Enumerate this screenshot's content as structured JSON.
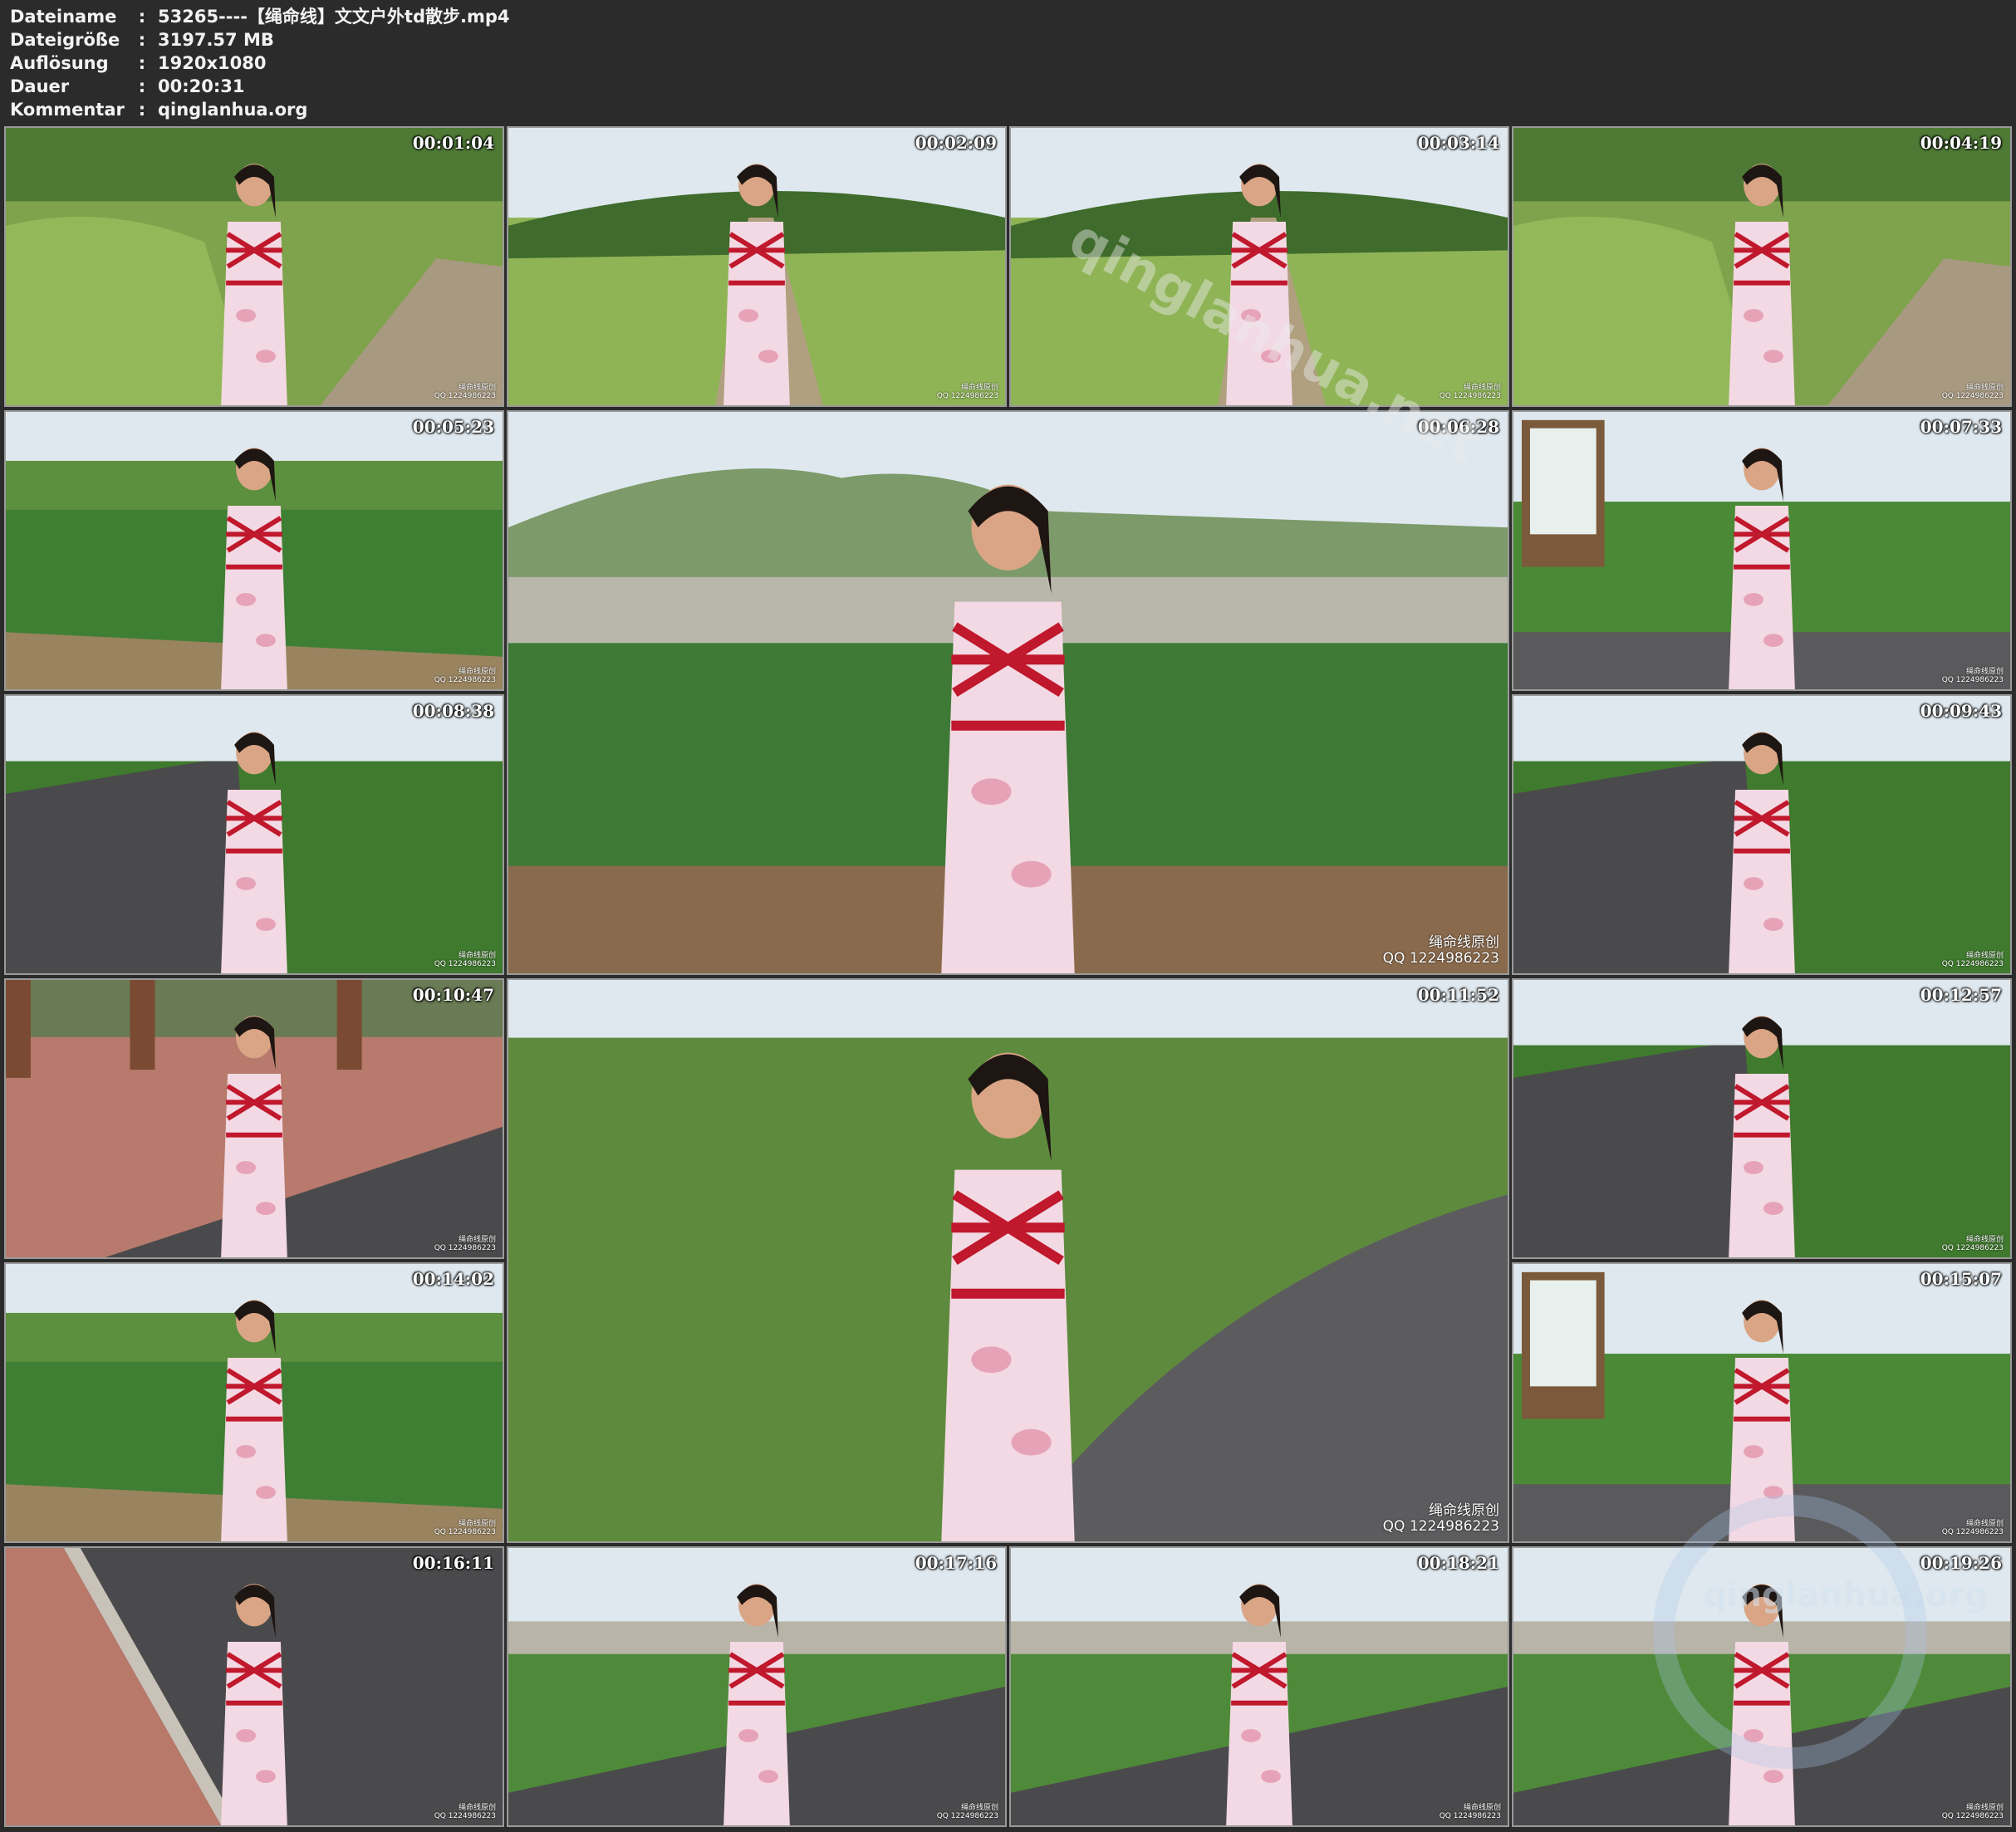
{
  "header": {
    "rows": [
      {
        "key": "Dateiname",
        "sep": ":",
        "value": "53265----【绳命线】文文户外td散步.mp4"
      },
      {
        "key": "Dateigröße",
        "sep": ":",
        "value": "3197.57 MB"
      },
      {
        "key": "Auflösung",
        "sep": ":",
        "value": "1920x1080"
      },
      {
        "key": "Dauer",
        "sep": ":",
        "value": "00:20:31"
      },
      {
        "key": "Kommentar",
        "sep": ":",
        "value": "qinglanhua.org"
      }
    ]
  },
  "thumbnails": [
    {
      "time": "00:01:04",
      "wm1": "绳命线原创",
      "wm2": "QQ 1224986223"
    },
    {
      "time": "00:02:09",
      "wm1": "绳命线原创",
      "wm2": "QQ 1224986223"
    },
    {
      "time": "00:03:14",
      "wm1": "绳命线原创",
      "wm2": "QQ 1224986223"
    },
    {
      "time": "00:04:19",
      "wm1": "绳命线原创",
      "wm2": "QQ 1224986223"
    },
    {
      "time": "00:05:23",
      "wm1": "绳命线原创",
      "wm2": "QQ 1224986223"
    },
    {
      "time": "00:06:28",
      "wm1": "绳命线原创",
      "wm2": "QQ 1224986223"
    },
    {
      "time": "00:07:33",
      "wm1": "绳命线原创",
      "wm2": "QQ 1224986223"
    },
    {
      "time": "00:08:38",
      "wm1": "绳命线原创",
      "wm2": "QQ 1224986223"
    },
    {
      "time": "00:09:43",
      "wm1": "绳命线原创",
      "wm2": "QQ 1224986223"
    },
    {
      "time": "00:10:47",
      "wm1": "绳命线原创",
      "wm2": "QQ 1224986223"
    },
    {
      "time": "00:11:52",
      "wm1": "绳命线原创",
      "wm2": "QQ 1224986223"
    },
    {
      "time": "00:12:57",
      "wm1": "绳命线原创",
      "wm2": "QQ 1224986223"
    },
    {
      "time": "00:14:02",
      "wm1": "绳命线原创",
      "wm2": "QQ 1224986223"
    },
    {
      "time": "00:15:07",
      "wm1": "绳命线原创",
      "wm2": "QQ 1224986223"
    },
    {
      "time": "00:16:11",
      "wm1": "绳命线原创",
      "wm2": "QQ 1224986223"
    },
    {
      "time": "00:17:16",
      "wm1": "绳命线原创",
      "wm2": "QQ 1224986223"
    },
    {
      "time": "00:18:21",
      "wm1": "绳命线原创",
      "wm2": "QQ 1224986223"
    },
    {
      "time": "00:19:26",
      "wm1": "绳命线原创",
      "wm2": "QQ 1224986223"
    }
  ],
  "overlays": {
    "diagonal_watermark": "qinglanhua.net",
    "corner_watermark": "qinglanhua.org"
  },
  "colors": {
    "background": "#2b2b2b",
    "text": "#f2f2f2",
    "border": "#9a9a9a",
    "rope": "#c0182c",
    "dress": "#f3d9e3",
    "grass": "#6a9a3c",
    "sky": "#dfe8ee",
    "path": "#4a4a4c"
  }
}
